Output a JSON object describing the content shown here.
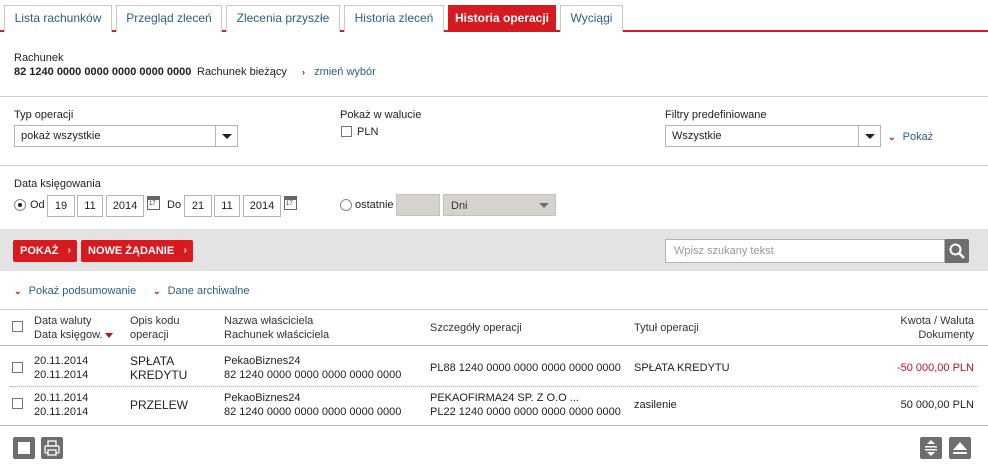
{
  "tabs": [
    {
      "label": "Lista rachunków"
    },
    {
      "label": "Przegląd zleceń"
    },
    {
      "label": "Zlecenia przyszłe"
    },
    {
      "label": "Historia zleceń"
    },
    {
      "label": "Historia operacji",
      "active": true
    },
    {
      "label": "Wyciągi"
    }
  ],
  "account": {
    "heading": "Rachunek",
    "number": "82 1240 0000 0000 0000 0000 0000",
    "type": "Rachunek bieżący",
    "change_link": "zmień wybór"
  },
  "filters": {
    "type_label": "Typ operacji",
    "type_value": "pokaż wszystkie",
    "currency_label": "Pokaż w walucie",
    "currency_option": "PLN",
    "predefined_label": "Filtry predefiniowane",
    "predefined_value": "Wszystkie",
    "show_link": "Pokaż"
  },
  "dates": {
    "label": "Data księgowania",
    "from_label": "Od",
    "from_day": "19",
    "from_month": "11",
    "from_year": "2014",
    "to_label": "Do",
    "to_day": "21",
    "to_month": "11",
    "to_year": "2014",
    "calendar_day": "17",
    "last_label": "ostatnie",
    "last_value": "",
    "unit_value": "Dni"
  },
  "toolbar": {
    "show_button": "POKAŻ",
    "new_request_button": "NOWE ŻĄDANIE",
    "search_placeholder": "Wpisz szukany tekst"
  },
  "links": {
    "summary": "Pokaż podsumowanie",
    "archive": "Dane archiwalne"
  },
  "table": {
    "headers": {
      "value_date": "Data waluty",
      "booking_date": "Data księgow.",
      "code_desc_1": "Opis kodu",
      "code_desc_2": "operacji",
      "owner_name": "Nazwa właściciela",
      "owner_account": "Rachunek właściciela",
      "details": "Szczegóły operacji",
      "title": "Tytuł operacji",
      "amount": "Kwota / Waluta",
      "documents": "Dokumenty"
    },
    "rows": [
      {
        "value_date": "20.11.2014",
        "booking_date": "20.11.2014",
        "code_1": "SPŁATA",
        "code_2": "KREDYTU",
        "owner_name": "PekaoBiznes24",
        "owner_account": "82 1240 0000 0000 0000 0000 0000",
        "details_1": "PL88 1240 0000 0000 0000 0000 0000",
        "details_2": "",
        "title": "SPŁATA KREDYTU",
        "amount": "-50 000,00 PLN"
      },
      {
        "value_date": "20.11.2014",
        "booking_date": "20.11.2014",
        "code_1": "PRZELEW",
        "code_2": "",
        "owner_name": "PekaoBiznes24",
        "owner_account": "82 1240 0000 0000 0000 0000 0000",
        "details_1": "PEKAOFIRMA24 SP. Z O.O ...",
        "details_2": "PL22 1240 0000 0000 0000 0000 0000",
        "title": "zasilenie",
        "amount": "50 000,00 PLN"
      }
    ]
  },
  "colors": {
    "accent": "#d71920",
    "link": "#2f5d8a",
    "toolbar_bg": "#e3e3e3"
  }
}
